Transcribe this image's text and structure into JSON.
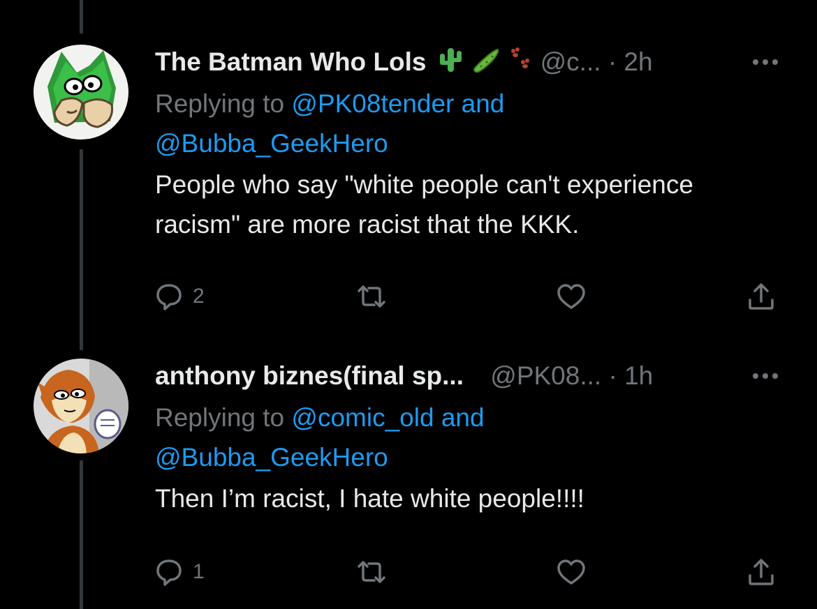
{
  "tweets": [
    {
      "display_name": "The Batman Who Lols",
      "name_emojis": [
        "cactus-emoji",
        "cucumber-emoji",
        "paw-prints-emoji"
      ],
      "handle": "@c...",
      "separator": "·",
      "time": "2h",
      "replying_prefix": "Replying to",
      "reply_mentions": [
        "@PK08tender",
        "@Bubba_GeekHero"
      ],
      "reply_joiner": "and",
      "text": "People who say \"white people can't experience racism\" are more racist that the KKK.",
      "reply_count": "2",
      "retweet_count": "",
      "like_count": ""
    },
    {
      "display_name": "anthony biznes(final sp...",
      "name_emojis": [],
      "handle": "@PK08...",
      "separator": "·",
      "time": "1h",
      "replying_prefix": "Replying to",
      "reply_mentions": [
        "@comic_old",
        "@Bubba_GeekHero"
      ],
      "reply_joiner": "and",
      "text": "Then I’m racist, I hate white people!!!!",
      "reply_count": "1",
      "retweet_count": "",
      "like_count": ""
    }
  ],
  "colors": {
    "background": "#000000",
    "primary_text": "#e7e9ea",
    "secondary_text": "#71767b",
    "link": "#1d9bf0",
    "thread_line": "#333639"
  },
  "icons": [
    "more-icon",
    "reply-icon",
    "retweet-icon",
    "like-icon",
    "share-icon"
  ]
}
